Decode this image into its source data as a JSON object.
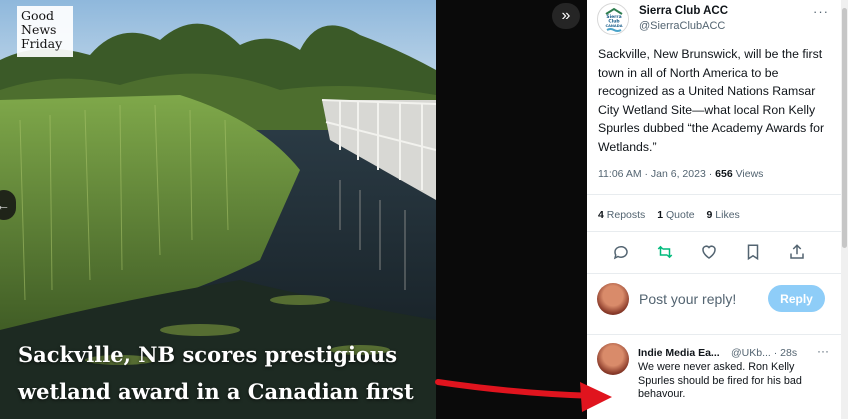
{
  "photo": {
    "logo_line1": "Good",
    "logo_line2": "News",
    "logo_line3": "Friday",
    "headline_line1": "Sackville, NB scores prestigious",
    "headline_line2": "wetland award in a Canadian first"
  },
  "tweet": {
    "author_name": "Sierra Club ACC",
    "author_handle": "@SierraClubACC",
    "avatar_text": "SIERRA CLUB CANADA",
    "text": "Sackville, New Brunswick, will be the first town in all of North America to be recognized as a United Nations Ramsar City Wetland Site—what local Ron Kelly Spurles dubbed “the Academy Awards for Wetlands.”",
    "time": "11:06 AM · Jan 6, 2023 · ",
    "views_count": "656",
    "views_label": " Views",
    "reposts_count": "4",
    "reposts_label": "Reposts",
    "quotes_count": "1",
    "quotes_label": "Quote",
    "likes_count": "9",
    "likes_label": "Likes"
  },
  "reply_box": {
    "placeholder": "Post your reply!",
    "button_label": "Reply"
  },
  "reply": {
    "name": "Indie Media Ea...",
    "handle": "@UKb... · 28s",
    "text": "We were never asked.  Ron Kelly Spurles should be fired for his bad behavour."
  },
  "colors": {
    "reply_button": "#8ecdf8",
    "repost_icon": "#00ba7c",
    "arrow": "#e0141e"
  }
}
